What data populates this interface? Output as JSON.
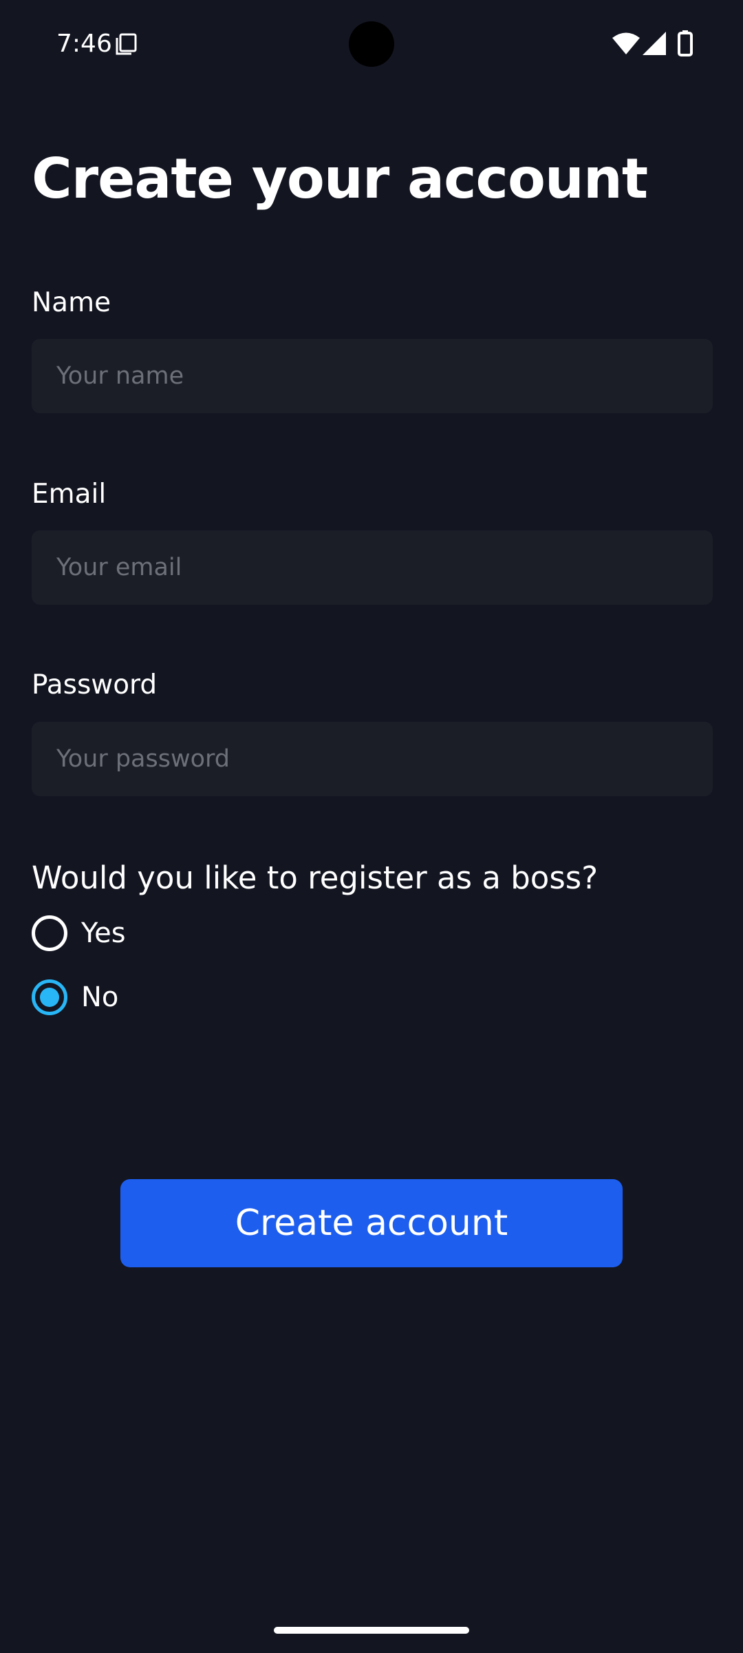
{
  "status_bar": {
    "time": "7:46",
    "icons": [
      "notification-icon",
      "wifi-icon",
      "signal-icon",
      "battery-icon"
    ]
  },
  "page": {
    "title": "Create your account"
  },
  "form": {
    "name": {
      "label": "Name",
      "value": "",
      "placeholder": "Your name"
    },
    "email": {
      "label": "Email",
      "value": "",
      "placeholder": "Your email"
    },
    "password": {
      "label": "Password",
      "value": "",
      "placeholder": "Your password"
    },
    "boss_question": {
      "label": "Would you like to register as a boss?",
      "options": [
        {
          "label": "Yes",
          "selected": false
        },
        {
          "label": "No",
          "selected": true
        }
      ]
    },
    "submit_label": "Create account"
  },
  "colors": {
    "background": "#131521",
    "field_background": "#1b1e27",
    "placeholder": "#6d7079",
    "accent_radio": "#29b6f6",
    "primary_button": "#1d5eef"
  }
}
